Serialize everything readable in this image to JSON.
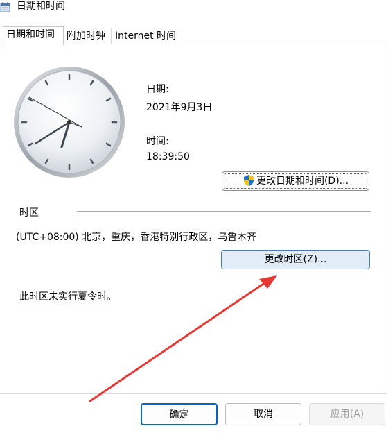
{
  "window": {
    "title": "日期和时间",
    "icon": "date-time-control-panel-icon"
  },
  "tabs": [
    {
      "label": "日期和时间",
      "active": true
    },
    {
      "label": "附加时钟",
      "active": false
    },
    {
      "label": "Internet 时间",
      "active": false
    }
  ],
  "datetime": {
    "date_label": "日期:",
    "date_value": "2021年9月3日",
    "time_label": "时间:",
    "time_value": "18:39:50",
    "change_button": "更改日期和时间(D)..."
  },
  "timezone": {
    "section_label": "时区",
    "value": "(UTC+08:00) 北京，重庆，香港特别行政区，乌鲁木齐",
    "change_button": "更改时区(Z)...",
    "dst_note": "此时区未实行夏令时。"
  },
  "footer": {
    "ok": "确定",
    "cancel": "取消",
    "apply": "应用(A)"
  },
  "colors": {
    "accent": "#0067c0",
    "arrow": "#e53935",
    "highlight_button_bg": "#e2ecf6"
  }
}
